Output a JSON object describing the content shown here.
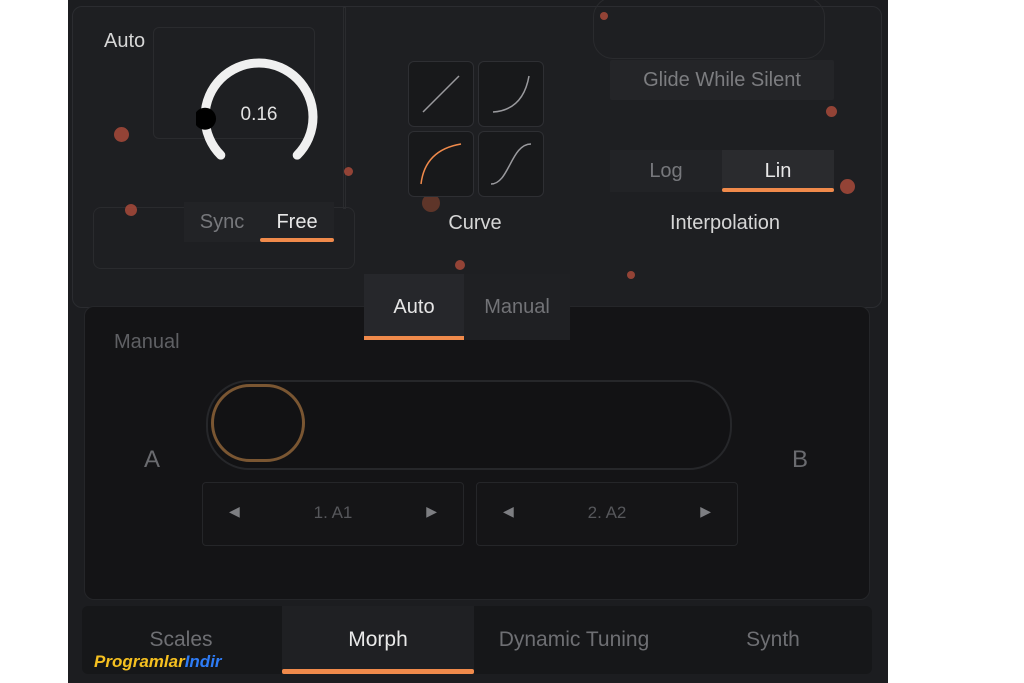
{
  "auto_section": {
    "title": "Auto",
    "knob": {
      "value": "0.16",
      "level": 0.16
    },
    "sync_free": {
      "options": [
        "Sync",
        "Free"
      ],
      "selected": "Free"
    }
  },
  "curve": {
    "label": "Curve",
    "options": [
      "linear-curve-icon",
      "exponential-curve-icon",
      "logarithmic-curve-icon",
      "s-curve-icon"
    ],
    "selected": "logarithmic-curve-icon"
  },
  "glide_button": "Glide While Silent",
  "interpolation": {
    "options": [
      "Log",
      "Lin"
    ],
    "selected": "Lin",
    "label": "Interpolation"
  },
  "mode_tabs": {
    "tabs": [
      "Auto",
      "Manual"
    ],
    "selected": "Auto"
  },
  "manual_section": {
    "title": "Manual",
    "left_label": "A",
    "right_label": "B",
    "preset_a": "1. A1",
    "preset_b": "2. A2"
  },
  "bottom_tabs": {
    "tabs": [
      "Scales",
      "Morph",
      "Dynamic Tuning",
      "Synth"
    ],
    "selected": "Morph"
  },
  "watermark": {
    "part1": "Programlar",
    "part2": "Indir"
  },
  "colors": {
    "accent": "#f08a4b",
    "background": "#1c1d20",
    "dot": "#a84a3a"
  }
}
